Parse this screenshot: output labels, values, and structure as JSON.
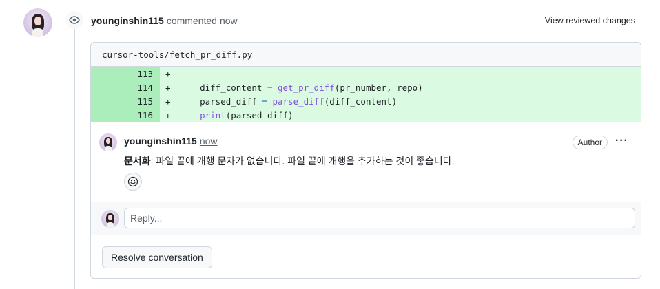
{
  "timeline": {
    "commenter": "younginshin115",
    "action_text": "commented",
    "time": "now",
    "view_changes_label": "View reviewed changes"
  },
  "file": {
    "path": "cursor-tools/fetch_pr_diff.py"
  },
  "diff_lines": [
    {
      "line": "113",
      "sign": "+",
      "code": ""
    },
    {
      "line": "114",
      "sign": "+",
      "code": "    diff_content = get_pr_diff(pr_number, repo)"
    },
    {
      "line": "115",
      "sign": "+",
      "code": "    parsed_diff = parse_diff(diff_content)"
    },
    {
      "line": "116",
      "sign": "+",
      "code": "    print(parsed_diff)"
    }
  ],
  "comment": {
    "author": "younginshin115",
    "time": "now",
    "badge": "Author",
    "more_label": "···",
    "body_prefix": "문서화",
    "body_text": ": 파일 끝에 개행 문자가 없습니다. 파일 끝에 개행을 추가하는 것이 좋습니다."
  },
  "reply": {
    "placeholder": "Reply..."
  },
  "actions": {
    "resolve_label": "Resolve conversation"
  },
  "icons": {
    "eye": "eye-icon",
    "smiley": "smiley-icon",
    "kebab": "kebab-horizontal-icon"
  },
  "colors": {
    "addition_line_bg": "#aceebb",
    "addition_code_bg": "#dafbe1",
    "border": "#d0d7de",
    "keyword_blue": "#0550ae",
    "function_purple": "#8250df"
  }
}
